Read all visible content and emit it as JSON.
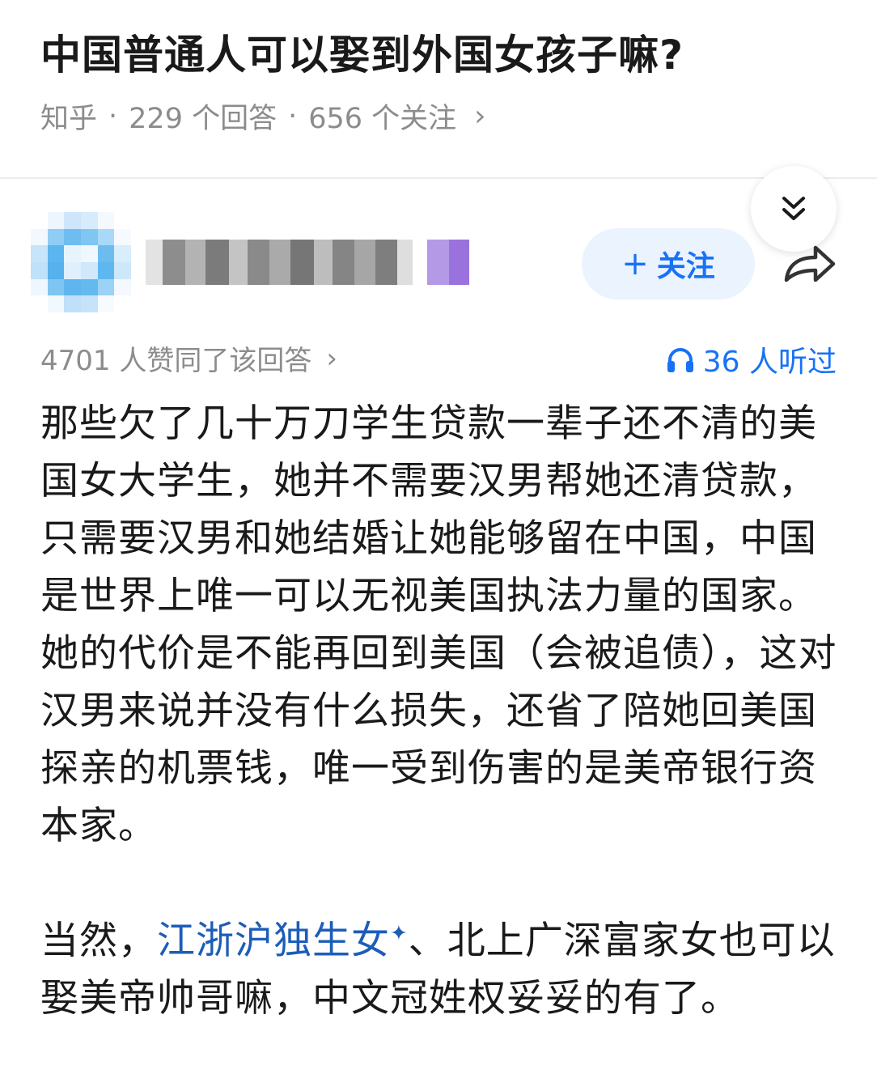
{
  "question": {
    "title": "中国普通人可以娶到外国女孩子嘛?",
    "source": "知乎",
    "answers": "229 个回答",
    "followers": "656 个关注",
    "separator": "·",
    "chevron": "›"
  },
  "author": {
    "follow_label": "关注",
    "follow_plus": "+"
  },
  "answer": {
    "approve_text": "4701 人赞同了该回答",
    "chevron": "›",
    "listen_text": "36 人听过",
    "para1": "那些欠了几十万刀学生贷款一辈子还不清的美国女大学生，她并不需要汉男帮她还清贷款，只需要汉男和她结婚让她能够留在中国，中国是世界上唯一可以无视美国执法力量的国家。她的代价是不能再回到美国（会被追债），这对汉男来说并没有什么损失，还省了陪她回美国探亲的机票钱，唯一受到伤害的是美帝银行资本家。",
    "para2_start": "当然，",
    "para2_link": "江浙沪独生女",
    "para2_link_mark": "✦",
    "para2_rest": "、北上广深富家女也可以娶美帝帅哥嘛，中文冠姓权妥妥的有了。"
  },
  "icons": {
    "collapse": "double-chevron-down-icon",
    "share": "share-arrow-icon",
    "listen": "headphones-icon"
  },
  "colors": {
    "accent": "#1772f6",
    "follow_bg": "#ebf3ff",
    "meta_gray": "#8c8c8c",
    "link": "#1c5db8"
  }
}
